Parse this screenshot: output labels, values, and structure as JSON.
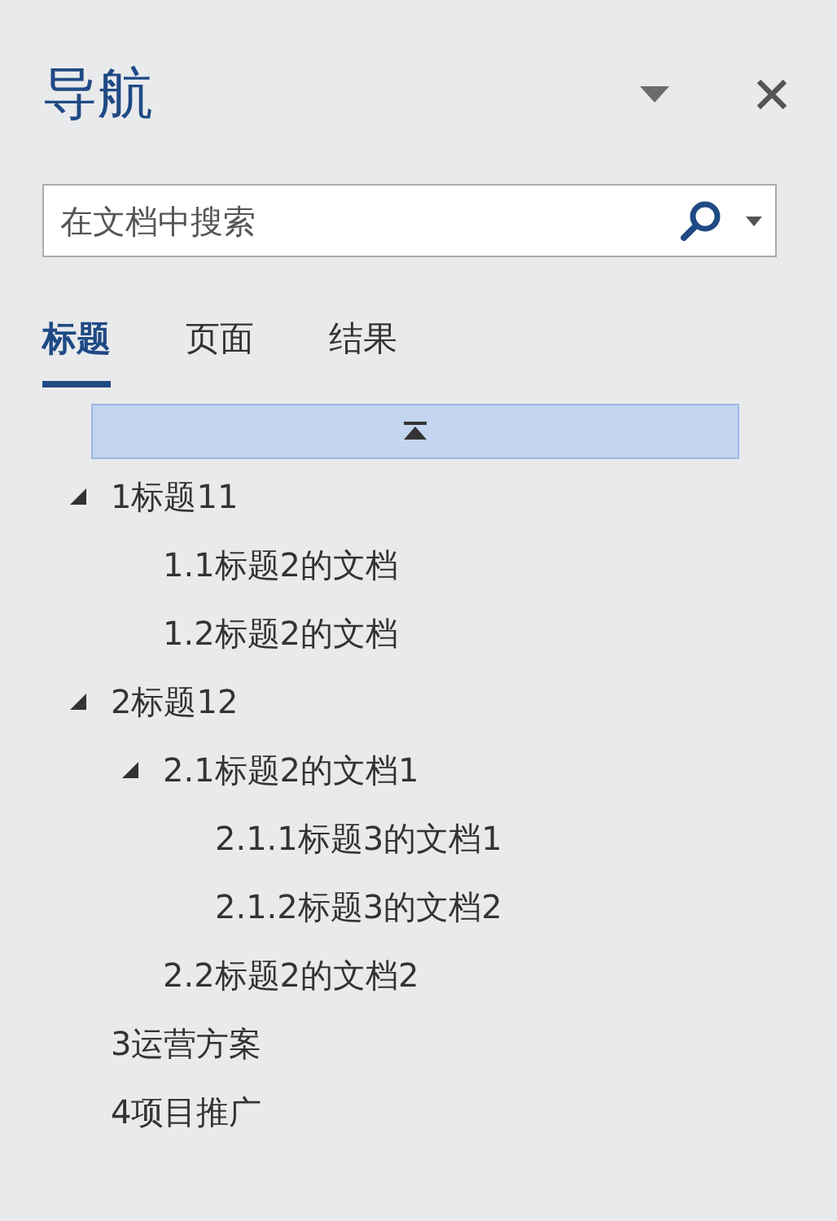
{
  "pane": {
    "title": "导航"
  },
  "search": {
    "placeholder": "在文档中搜索"
  },
  "tabs": [
    {
      "label": "标题",
      "selected": true
    },
    {
      "label": "页面",
      "selected": false
    },
    {
      "label": "结果",
      "selected": false
    }
  ],
  "headings": [
    {
      "label": "1标题11",
      "expanded": true,
      "children": [
        {
          "label": "1.1标题2的文档"
        },
        {
          "label": "1.2标题2的文档"
        }
      ]
    },
    {
      "label": "2标题12",
      "expanded": true,
      "children": [
        {
          "label": "2.1标题2的文档1",
          "expanded": true,
          "children": [
            {
              "label": "2.1.1标题3的文档1"
            },
            {
              "label": "2.1.2标题3的文档2"
            }
          ]
        },
        {
          "label": "2.2标题2的文档2"
        }
      ]
    },
    {
      "label": "3运营方案"
    },
    {
      "label": "4项目推广"
    }
  ]
}
